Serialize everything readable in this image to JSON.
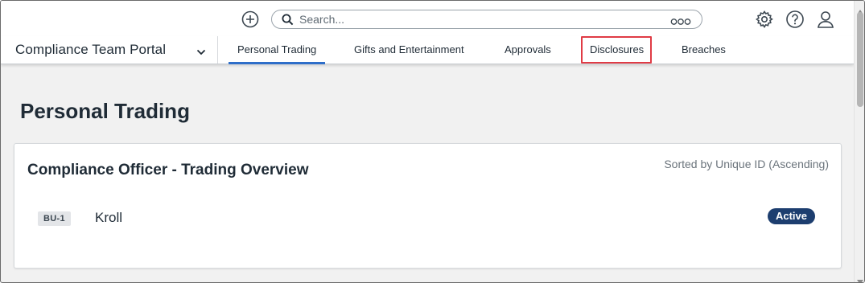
{
  "topbar": {
    "search_placeholder": "Search...",
    "icons": [
      "add-circle-icon",
      "search-icon",
      "more-icon",
      "settings-icon",
      "help-icon",
      "user-icon"
    ]
  },
  "nav": {
    "portal_name": "Compliance Team Portal",
    "tabs": [
      {
        "label": "Personal Trading",
        "active": true
      },
      {
        "label": "Gifts and Entertainment",
        "active": false
      },
      {
        "label": "Approvals",
        "active": false
      },
      {
        "label": "Disclosures",
        "active": false,
        "highlighted": true
      },
      {
        "label": "Breaches",
        "active": false
      }
    ]
  },
  "page": {
    "title": "Personal Trading",
    "card": {
      "title": "Compliance Officer - Trading Overview",
      "sort_note": "Sorted by Unique ID (Ascending)",
      "rows": [
        {
          "id": "BU-1",
          "name": "Kroll",
          "status": "Active"
        }
      ]
    }
  },
  "colors": {
    "accent": "#2e6ec9",
    "highlight": "#e03b45",
    "status_active": "#1d3e6f",
    "page_bg": "#f1f1f1"
  }
}
